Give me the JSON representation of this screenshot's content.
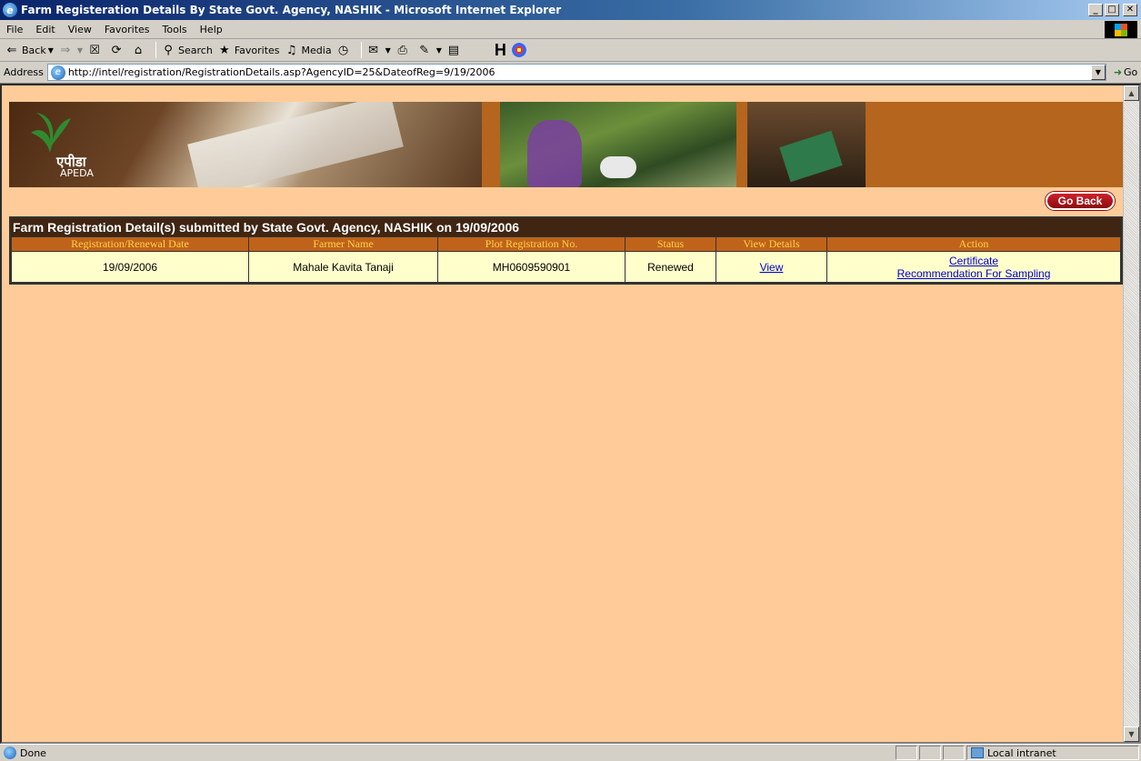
{
  "window": {
    "title": "Farm Registeration Details By State Govt. Agency, NASHIK - Microsoft Internet Explorer",
    "minimize": "_",
    "maximize": "□",
    "close": "✕"
  },
  "menu": [
    "File",
    "Edit",
    "View",
    "Favorites",
    "Tools",
    "Help"
  ],
  "toolbar": {
    "back": "Back",
    "search": "Search",
    "favorites": "Favorites",
    "media": "Media",
    "h_button": "H"
  },
  "address": {
    "label": "Address",
    "url": "http://intel/registration/RegistrationDetails.asp?AgencyID=25&DateofReg=9/19/2006",
    "go": "Go"
  },
  "banner": {
    "logo_hindi": "एपीडा",
    "logo_english": "APEDA"
  },
  "go_back_label": "Go Back",
  "table": {
    "heading": "Farm Registration Detail(s) submitted by State Govt. Agency, NASHIK on 19/09/2006",
    "columns": [
      "Registration/Renewal Date",
      "Farmer Name",
      "Plot Registration No.",
      "Status",
      "View Details",
      "Action"
    ],
    "rows": [
      {
        "date": "19/09/2006",
        "farmer": "Mahale Kavita Tanaji",
        "plot_no": "MH0609590901",
        "status": "Renewed",
        "view": "View",
        "action_certificate": "Certificate",
        "action_sampling": "Recommendation For Sampling"
      }
    ]
  },
  "status": {
    "text": "Done",
    "zone": "Local intranet"
  },
  "icons": {
    "up_arrow": "▲",
    "down_arrow": "▼"
  }
}
